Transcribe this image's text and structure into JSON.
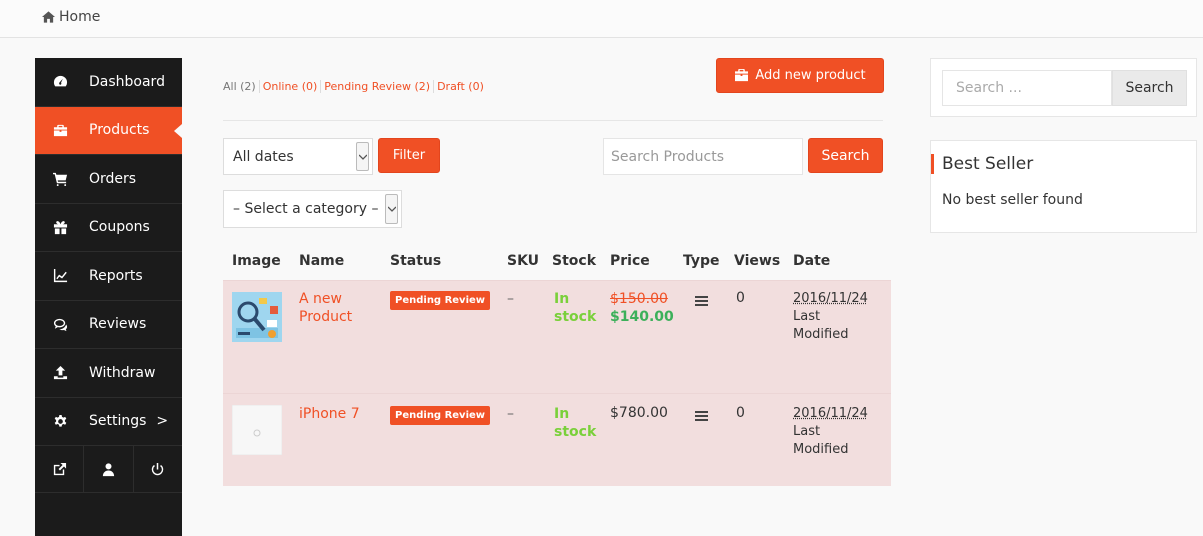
{
  "breadcrumb": {
    "label": "Home"
  },
  "sidebar": {
    "items": [
      {
        "label": "Dashboard",
        "icon": "dashboard-icon"
      },
      {
        "label": "Products",
        "icon": "briefcase-icon",
        "active": true
      },
      {
        "label": "Orders",
        "icon": "cart-icon"
      },
      {
        "label": "Coupons",
        "icon": "gift-icon"
      },
      {
        "label": "Reports",
        "icon": "line-chart-icon"
      },
      {
        "label": "Reviews",
        "icon": "comments-icon"
      },
      {
        "label": "Withdraw",
        "icon": "upload-icon"
      },
      {
        "label": "Settings",
        "icon": "gear-icon",
        "chevron": ">"
      }
    ],
    "bottom_icons": [
      "external-link-icon",
      "user-icon",
      "power-icon"
    ]
  },
  "status_tabs": [
    {
      "label": "All (2)"
    },
    {
      "label": "Online (0)"
    },
    {
      "label": "Pending Review (2)"
    },
    {
      "label": "Draft (0)"
    }
  ],
  "toolbar": {
    "add_label": "Add new product",
    "date_select": "All dates",
    "filter_label": "Filter",
    "category_select": "– Select a category –",
    "search_placeholder": "Search Products",
    "search_label": "Search"
  },
  "table": {
    "headers": [
      "Image",
      "Name",
      "Status",
      "SKU",
      "Stock",
      "Price",
      "Type",
      "Views",
      "Date"
    ],
    "rows": [
      {
        "name_line1": "A new",
        "name_line2": "Product",
        "status": "Pending Review",
        "sku": "–",
        "stock_line1": "In",
        "stock_line2": "stock",
        "price_old": "$150.00",
        "price_new": "$140.00",
        "views": "0",
        "date": "2016/11/24",
        "date_sub1": "Last",
        "date_sub2": "Modified"
      },
      {
        "name_line1": "iPhone 7",
        "status": "Pending Review",
        "sku": "–",
        "stock_line1": "In",
        "stock_line2": "stock",
        "price": "$780.00",
        "views": "0",
        "date": "2016/11/24",
        "date_sub1": "Last",
        "date_sub2": "Modified"
      }
    ]
  },
  "widgets": {
    "search": {
      "placeholder": "Search ...",
      "button": "Search"
    },
    "best_seller": {
      "title": "Best Seller",
      "message": "No best seller found"
    }
  },
  "colors": {
    "accent": "#f05025",
    "sidebar_bg": "#1b1b1b",
    "row_bg": "#f2dede",
    "in_stock": "#7ad03a",
    "sale_price": "#3cb05a"
  }
}
